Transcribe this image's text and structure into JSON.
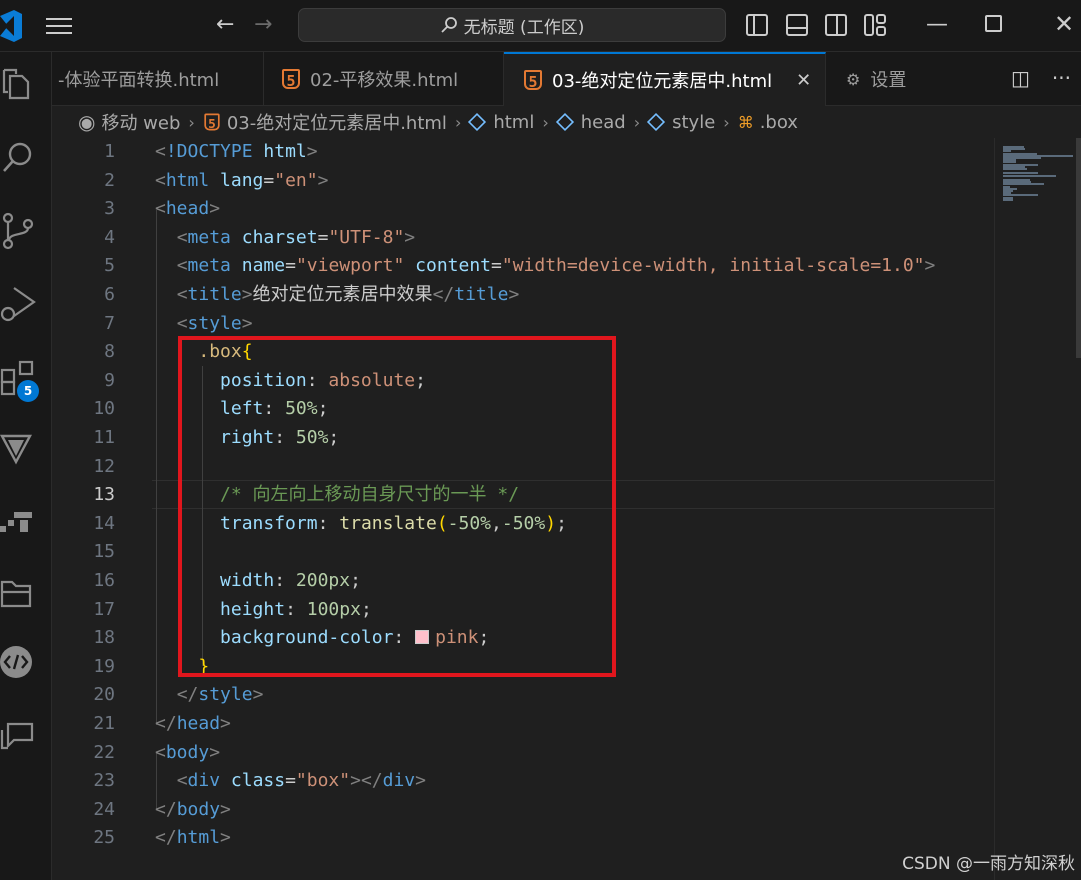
{
  "titlebar": {
    "search_text": "无标题 (工作区)"
  },
  "tabs": [
    {
      "label": "-体验平面转换.html",
      "active": false
    },
    {
      "label": "02-平移效果.html",
      "active": false
    },
    {
      "label": "03-绝对定位元素居中.html",
      "active": true
    },
    {
      "label": "设置",
      "active": false
    }
  ],
  "activity": {
    "extensions_badge": "5"
  },
  "breadcrumb": {
    "items": [
      "移动 web",
      "03-绝对定位元素居中.html",
      "html",
      "head",
      "style",
      ".box"
    ]
  },
  "editor": {
    "active_line": 13,
    "line_numbers": [
      "1",
      "2",
      "3",
      "4",
      "5",
      "6",
      "7",
      "8",
      "9",
      "10",
      "11",
      "12",
      "13",
      "14",
      "15",
      "16",
      "17",
      "18",
      "19",
      "20",
      "21",
      "22",
      "23",
      "24",
      "25"
    ],
    "lines": [
      [
        [
          "br",
          "<"
        ],
        [
          "tag",
          "!DOCTYPE"
        ],
        [
          "text",
          " "
        ],
        [
          "attr",
          "html"
        ],
        [
          "br",
          ">"
        ]
      ],
      [
        [
          "br",
          "<"
        ],
        [
          "tag",
          "html"
        ],
        [
          "text",
          " "
        ],
        [
          "attr",
          "lang"
        ],
        [
          "punc",
          "="
        ],
        [
          "str",
          "\"en\""
        ],
        [
          "br",
          ">"
        ]
      ],
      [
        [
          "br",
          "<"
        ],
        [
          "tag",
          "head"
        ],
        [
          "br",
          ">"
        ]
      ],
      [
        [
          "text",
          "  "
        ],
        [
          "br",
          "<"
        ],
        [
          "tag",
          "meta"
        ],
        [
          "text",
          " "
        ],
        [
          "attr",
          "charset"
        ],
        [
          "punc",
          "="
        ],
        [
          "str",
          "\"UTF-8\""
        ],
        [
          "br",
          ">"
        ]
      ],
      [
        [
          "text",
          "  "
        ],
        [
          "br",
          "<"
        ],
        [
          "tag",
          "meta"
        ],
        [
          "text",
          " "
        ],
        [
          "attr",
          "name"
        ],
        [
          "punc",
          "="
        ],
        [
          "str",
          "\"viewport\""
        ],
        [
          "text",
          " "
        ],
        [
          "attr",
          "content"
        ],
        [
          "punc",
          "="
        ],
        [
          "str",
          "\"width=device-width, initial-scale=1.0\""
        ],
        [
          "br",
          ">"
        ]
      ],
      [
        [
          "text",
          "  "
        ],
        [
          "br",
          "<"
        ],
        [
          "tag",
          "title"
        ],
        [
          "br",
          ">"
        ],
        [
          "text",
          "绝对定位元素居中效果"
        ],
        [
          "br",
          "</"
        ],
        [
          "tag",
          "title"
        ],
        [
          "br",
          ">"
        ]
      ],
      [
        [
          "text",
          "  "
        ],
        [
          "br",
          "<"
        ],
        [
          "tag",
          "style"
        ],
        [
          "br",
          ">"
        ]
      ],
      [
        [
          "text",
          "    "
        ],
        [
          "sel",
          ".box"
        ],
        [
          "brace",
          "{"
        ]
      ],
      [
        [
          "text",
          "      "
        ],
        [
          "prop",
          "position"
        ],
        [
          "punc",
          ": "
        ],
        [
          "val",
          "absolute"
        ],
        [
          "punc",
          ";"
        ]
      ],
      [
        [
          "text",
          "      "
        ],
        [
          "prop",
          "left"
        ],
        [
          "punc",
          ": "
        ],
        [
          "num",
          "50%"
        ],
        [
          "punc",
          ";"
        ]
      ],
      [
        [
          "text",
          "      "
        ],
        [
          "prop",
          "right"
        ],
        [
          "punc",
          ": "
        ],
        [
          "num",
          "50%"
        ],
        [
          "punc",
          ";"
        ]
      ],
      [],
      [
        [
          "text",
          "      "
        ],
        [
          "com",
          "/* 向左向上移动自身尺寸的一半 */"
        ]
      ],
      [
        [
          "text",
          "      "
        ],
        [
          "prop",
          "transform"
        ],
        [
          "punc",
          ": "
        ],
        [
          "fn",
          "translate"
        ],
        [
          "brace",
          "("
        ],
        [
          "num",
          "-50%"
        ],
        [
          "punc",
          ","
        ],
        [
          "num",
          "-50%"
        ],
        [
          "brace",
          ")"
        ],
        [
          "punc",
          ";"
        ]
      ],
      [],
      [
        [
          "text",
          "      "
        ],
        [
          "prop",
          "width"
        ],
        [
          "punc",
          ": "
        ],
        [
          "num",
          "200px"
        ],
        [
          "punc",
          ";"
        ]
      ],
      [
        [
          "text",
          "      "
        ],
        [
          "prop",
          "height"
        ],
        [
          "punc",
          ": "
        ],
        [
          "num",
          "100px"
        ],
        [
          "punc",
          ";"
        ]
      ],
      [
        [
          "text",
          "      "
        ],
        [
          "prop",
          "background-color"
        ],
        [
          "punc",
          ": "
        ],
        [
          "swatch",
          "#ffc0cb"
        ],
        [
          "val",
          "pink"
        ],
        [
          "punc",
          ";"
        ]
      ],
      [
        [
          "text",
          "    "
        ],
        [
          "brace",
          "}"
        ]
      ],
      [
        [
          "text",
          "  "
        ],
        [
          "br",
          "</"
        ],
        [
          "tag",
          "style"
        ],
        [
          "br",
          ">"
        ]
      ],
      [
        [
          "br",
          "</"
        ],
        [
          "tag",
          "head"
        ],
        [
          "br",
          ">"
        ]
      ],
      [
        [
          "br",
          "<"
        ],
        [
          "tag",
          "body"
        ],
        [
          "br",
          ">"
        ]
      ],
      [
        [
          "text",
          "  "
        ],
        [
          "br",
          "<"
        ],
        [
          "tag",
          "div"
        ],
        [
          "text",
          " "
        ],
        [
          "attr",
          "class"
        ],
        [
          "punc",
          "="
        ],
        [
          "str",
          "\"box\""
        ],
        [
          "br",
          "></"
        ],
        [
          "tag",
          "div"
        ],
        [
          "br",
          ">"
        ]
      ],
      [
        [
          "br",
          "</"
        ],
        [
          "tag",
          "body"
        ],
        [
          "br",
          ">"
        ]
      ],
      [
        [
          "br",
          "</"
        ],
        [
          "tag",
          "html"
        ],
        [
          "br",
          ">"
        ]
      ]
    ]
  },
  "colors": {
    "accent": "#0078d4",
    "highlight_box": "#e0161d",
    "html_icon": "#e37933"
  },
  "watermark": "CSDN @一雨方知深秋"
}
